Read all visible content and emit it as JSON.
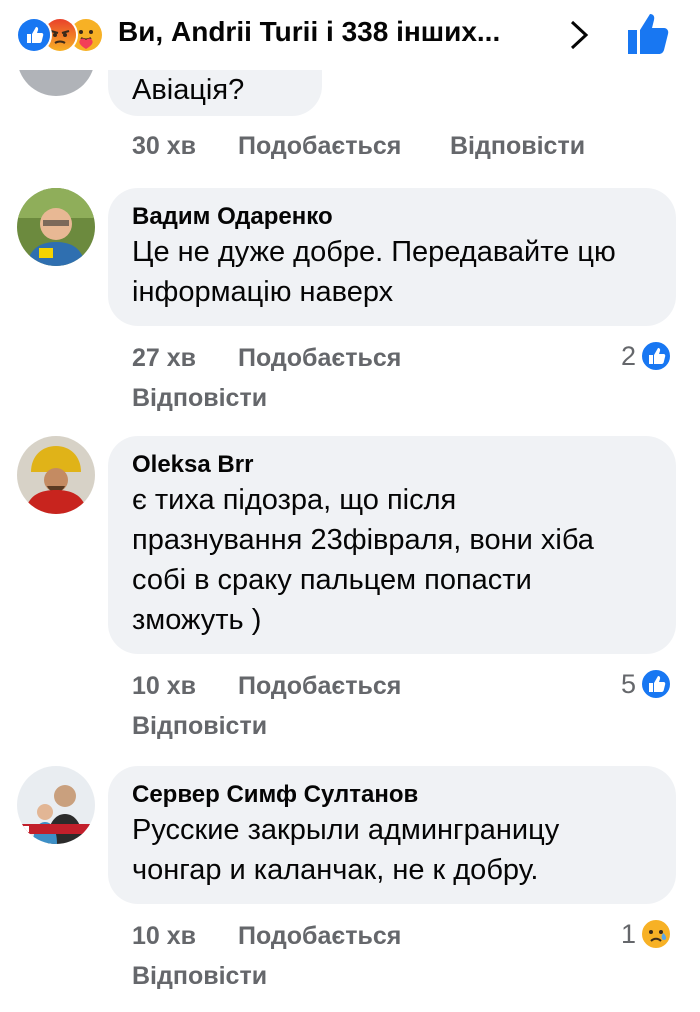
{
  "header": {
    "title": "Ви, Andrii Turii і 338 інших...",
    "reaction_icons": [
      "like-icon",
      "angry-icon",
      "care-icon"
    ],
    "colors": {
      "like": "#1877f2",
      "angry": "#f0663a",
      "care": "#f7b125"
    }
  },
  "top_comment": {
    "text_tail": "Авіація?",
    "time": "30 хв",
    "like_label": "Подобається",
    "reply_label": "Відповісти"
  },
  "comments": [
    {
      "author": "Вадим Одаренко",
      "lines": [
        "Це не дуже добре. Передавайте цю",
        "інформацію наверх"
      ],
      "time": "27 хв",
      "like_label": "Подобається",
      "reply_label": "Відповісти",
      "reaction_count": "2",
      "reaction_icon": "like-icon"
    },
    {
      "author": "Oleksa Brr",
      "lines": [
        "є тиха підозра, що після",
        "празнування 23фівраля, вони хіба",
        "собі в сраку пальцем попасти",
        "зможуть )"
      ],
      "time": "10 хв",
      "like_label": "Подобається",
      "reply_label": "Відповісти",
      "reaction_count": "5",
      "reaction_icon": "like-icon"
    },
    {
      "author": "Сервер Симф Султанов",
      "lines": [
        "Русские закрыли админграницу",
        "чонгар и каланчак, не к добру."
      ],
      "time": "10 хв",
      "like_label": "Подобається",
      "reply_label": "Відповісти",
      "reaction_count": "1",
      "reaction_icon": "sad-icon"
    }
  ]
}
